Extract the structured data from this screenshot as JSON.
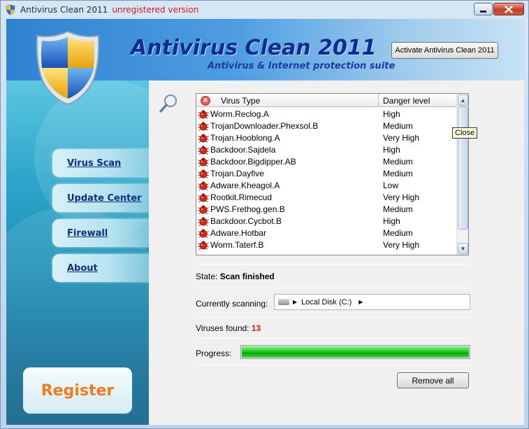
{
  "window": {
    "title": "Antivirus Clean 2011",
    "unregistered": "unregistered version"
  },
  "header": {
    "app_title": "Antivirus Clean 2011",
    "subtitle": "Antivirus & Internet protection suite",
    "activate_label": "Activate Antivirus Clean 2011"
  },
  "sidebar": {
    "items": [
      {
        "label": "Virus Scan"
      },
      {
        "label": "Update Center"
      },
      {
        "label": "Firewall"
      },
      {
        "label": "About"
      }
    ],
    "register_label": "Register"
  },
  "virus_list": {
    "col_type": "Virus Type",
    "col_level": "Danger level",
    "rows": [
      {
        "name": "Worm.Reclog.A",
        "level": "High"
      },
      {
        "name": "TrojanDownloader.Phexsol.B",
        "level": "Medium"
      },
      {
        "name": "Trojan.Hooblong.A",
        "level": "Very High"
      },
      {
        "name": "Backdoor.Sajdela",
        "level": "High"
      },
      {
        "name": "Backdoor.Bigdipper.AB",
        "level": "Medium"
      },
      {
        "name": "Trojan.Dayfive",
        "level": "Medium"
      },
      {
        "name": "Adware.Kheagol.A",
        "level": "Low"
      },
      {
        "name": "Rootkit.Rimecud",
        "level": "Very High"
      },
      {
        "name": "PWS.Frethog.gen.B",
        "level": "Medium"
      },
      {
        "name": "Backdoor.Cycbot.B",
        "level": "High"
      },
      {
        "name": "Adware.Hotbar",
        "level": "Medium"
      },
      {
        "name": "Worm.Taterf.B",
        "level": "Very High"
      }
    ]
  },
  "tooltip": "Close",
  "status": {
    "state_label": "State:",
    "state_value": "Scan finished",
    "scanning_label": "Currently scanning:",
    "scanning_path": "Local Disk (C:)",
    "found_label": "Viruses found:",
    "found_value": "13",
    "progress_label": "Progress:",
    "progress_fraction": 1.0
  },
  "remove_label": "Remove all",
  "colors": {
    "accent": "#0d2d8f",
    "danger": "#e0190f",
    "register": "#ef7b1f",
    "progress": "#2fcf2f"
  },
  "icons": {
    "app": "shield-icon",
    "list_header": "virus-alert-icon",
    "row": "bug-icon",
    "search": "magnifier-icon",
    "drive": "hard-drive-icon"
  }
}
